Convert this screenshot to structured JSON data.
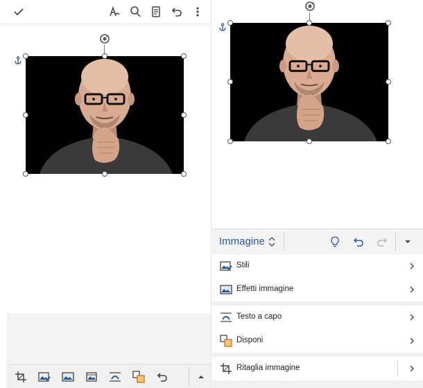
{
  "left_screen": {
    "toolbar": {
      "confirm_icon": "checkmark-icon",
      "icons": [
        "pen-draw-icon",
        "search-icon",
        "reading-view-icon",
        "undo-icon",
        "more-icon"
      ]
    },
    "bottom_toolbar": {
      "icons": [
        "crop-icon",
        "picture-styles-icon",
        "picture-effects-icon",
        "picture-options-icon",
        "wrap-text-icon",
        "arrange-icon",
        "undo-icon",
        "expand-up-icon"
      ]
    }
  },
  "right_screen": {
    "ribbon": {
      "tab_label": "Immagine",
      "icons": [
        "tab-switch-icon",
        "lightbulb-icon",
        "undo-icon",
        "redo-icon",
        "collapse-icon"
      ]
    },
    "menu": {
      "items": [
        {
          "label": "Stili",
          "icon": "picture-styles-icon"
        },
        {
          "label": "Effetti immagine",
          "icon": "picture-effects-icon"
        },
        {
          "label": "Testo a capo",
          "icon": "wrap-text-icon"
        },
        {
          "label": "Disponi",
          "icon": "arrange-icon"
        },
        {
          "label": "Ritaglia immagine",
          "icon": "crop-icon"
        }
      ]
    }
  },
  "colors": {
    "accent": "#2b579a",
    "photo_background": "#000000",
    "toolbar_bg": "#f0f0f0",
    "ribbon_bg": "#f3f3f3"
  }
}
